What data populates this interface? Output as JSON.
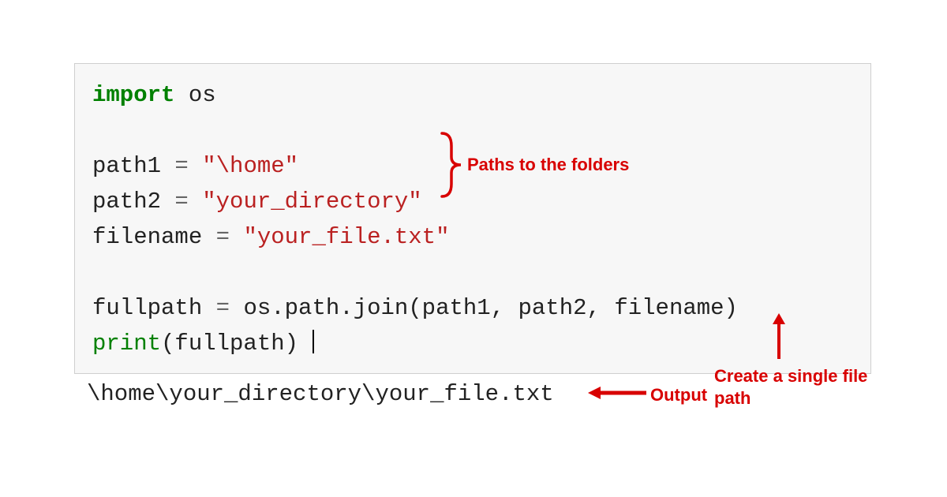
{
  "code": {
    "line1_import": "import",
    "line1_os": " os",
    "line3_var": "path1 ",
    "line3_eq": "=",
    "line3_str": " \"\\home\"",
    "line4_var": "path2 ",
    "line4_eq": "=",
    "line4_str": " \"your_directory\"",
    "line5_var": "filename ",
    "line5_eq": "=",
    "line5_str": " \"your_file.txt\"",
    "line7_lhs": "fullpath ",
    "line7_eq": "=",
    "line7_rhs": " os.path.join(path1, path2, filename)",
    "line8_print": "print",
    "line8_args": "(fullpath)"
  },
  "output": "\\home\\your_directory\\your_file.txt",
  "annotations": {
    "paths": "Paths to the folders",
    "create": "Create a single file\npath",
    "output": "Output"
  }
}
